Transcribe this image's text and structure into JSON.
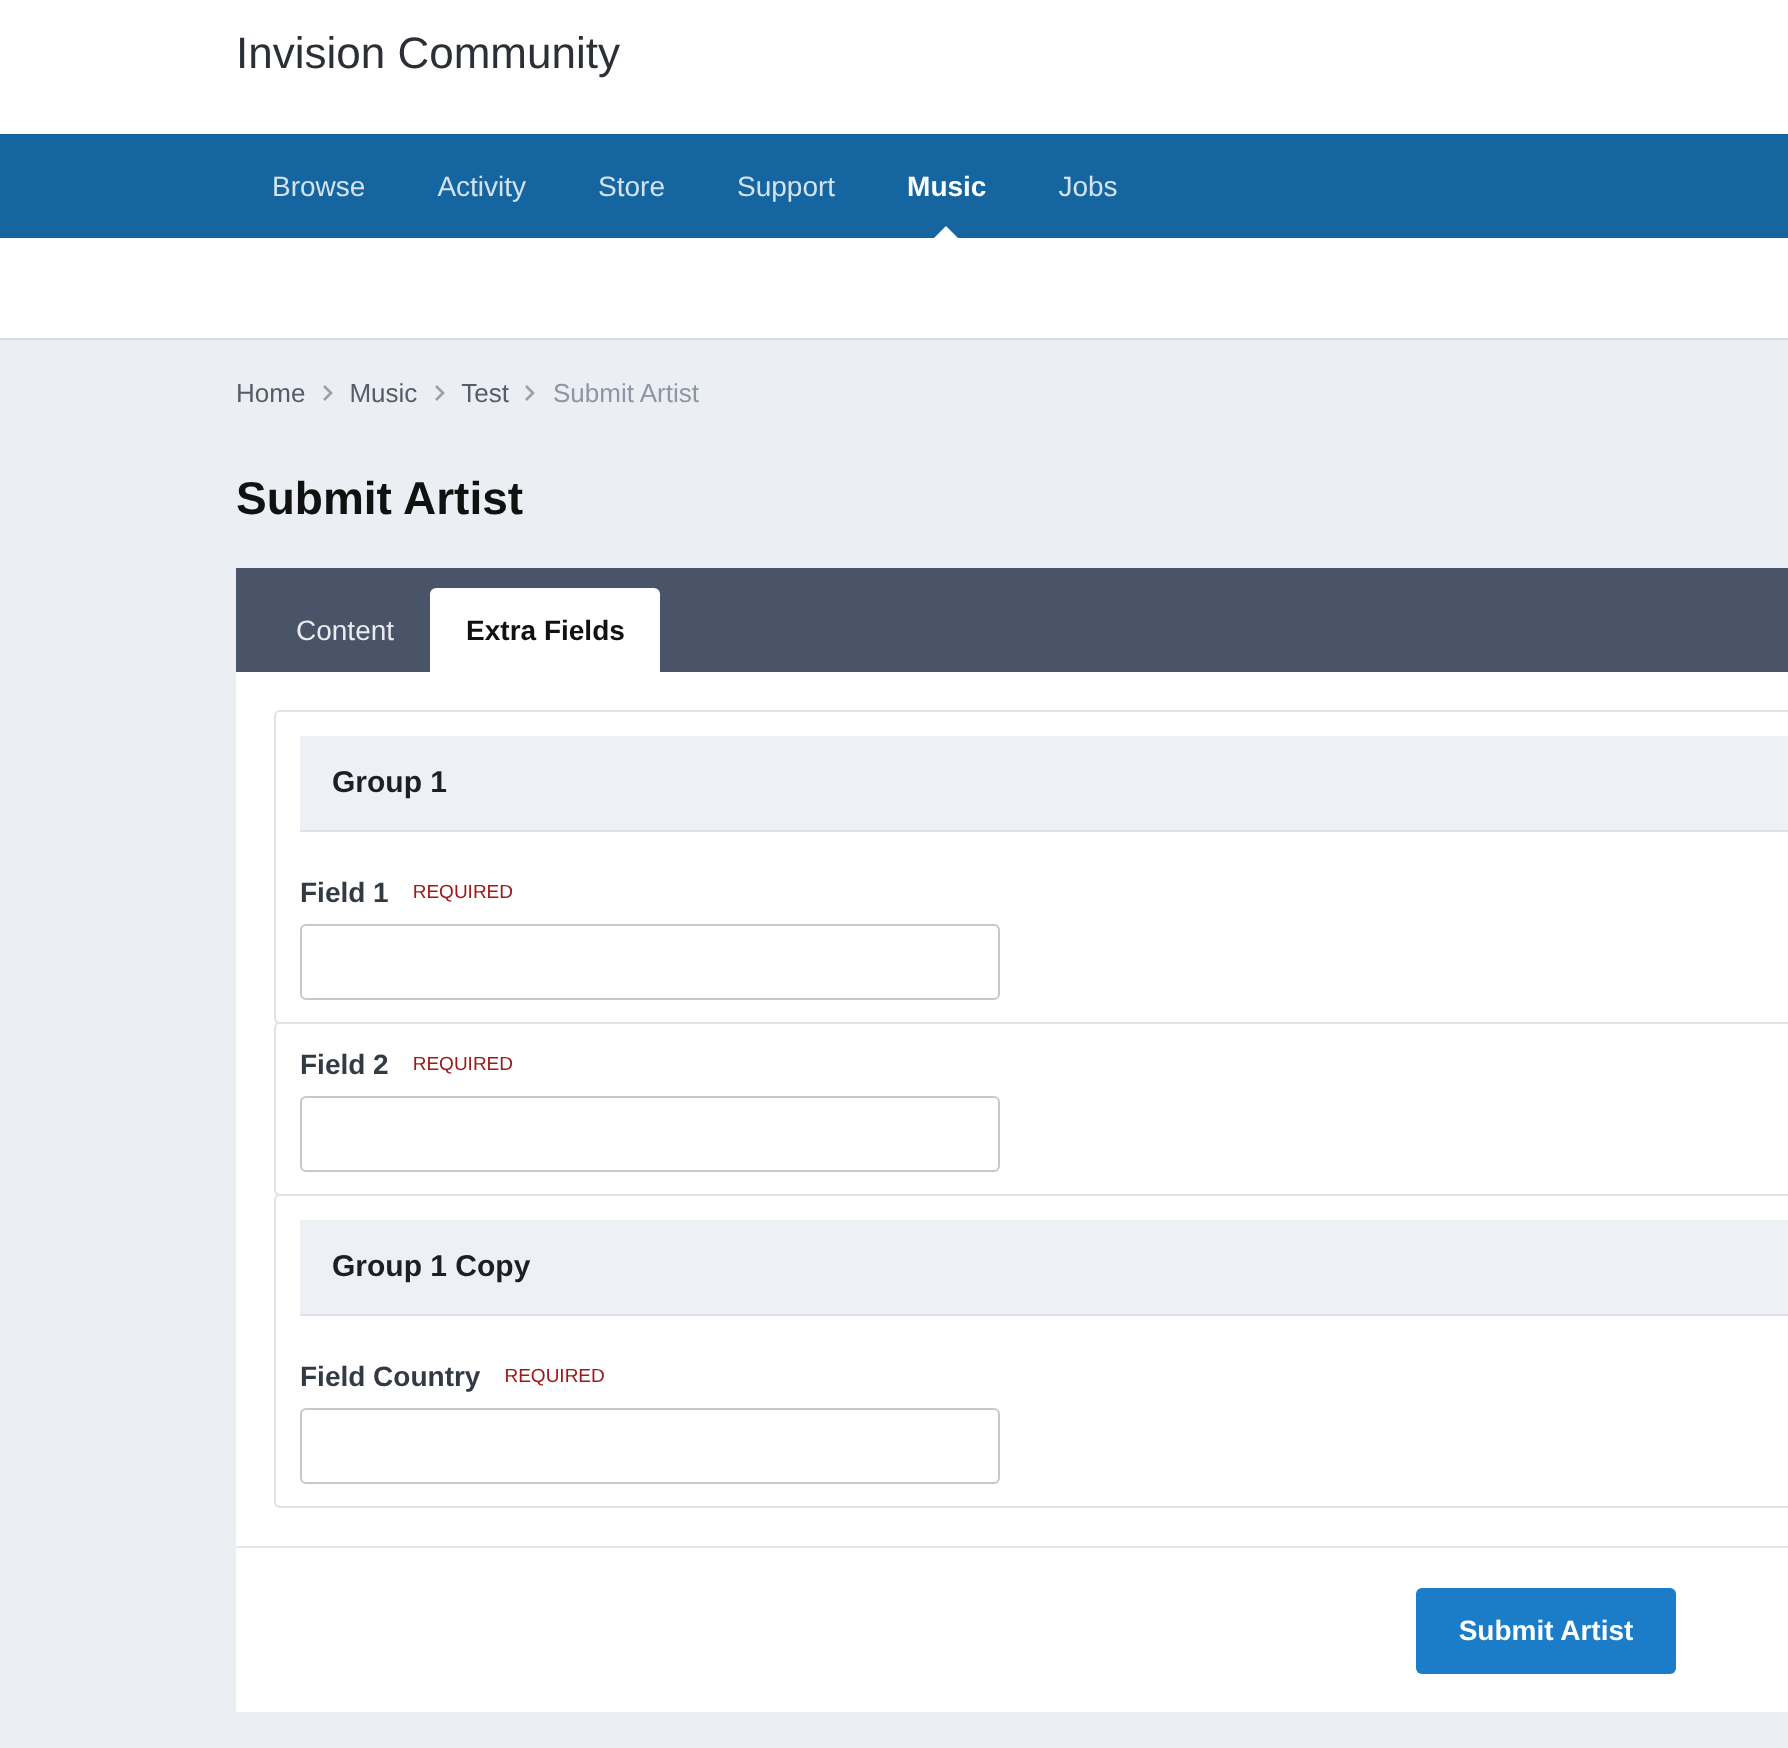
{
  "header": {
    "title": "Invision Community"
  },
  "nav": [
    {
      "label": "Browse",
      "selected": false
    },
    {
      "label": "Activity",
      "selected": false
    },
    {
      "label": "Store",
      "selected": false
    },
    {
      "label": "Support",
      "selected": false
    },
    {
      "label": "Music",
      "selected": true
    },
    {
      "label": "Jobs",
      "selected": false
    }
  ],
  "breadcrumb": [
    {
      "label": "Home",
      "current": false
    },
    {
      "label": "Music",
      "current": false
    },
    {
      "label": "Test",
      "current": false
    },
    {
      "label": "Submit Artist",
      "current": true
    }
  ],
  "page_title": "Submit Artist",
  "tabs": [
    {
      "label": "Content",
      "selected": false
    },
    {
      "label": "Extra Fields",
      "selected": true
    }
  ],
  "sections": [
    {
      "heading": "Group 1",
      "fields": [
        {
          "label": "Field 1",
          "badge": "REQUIRED"
        }
      ]
    },
    {
      "fields": [
        {
          "label": "Field 2",
          "badge": "REQUIRED"
        }
      ]
    },
    {
      "heading": "Group 1 Copy",
      "fields": [
        {
          "label": "Field Country",
          "badge": "REQUIRED"
        }
      ]
    }
  ],
  "submit_button": "Submit Artist"
}
